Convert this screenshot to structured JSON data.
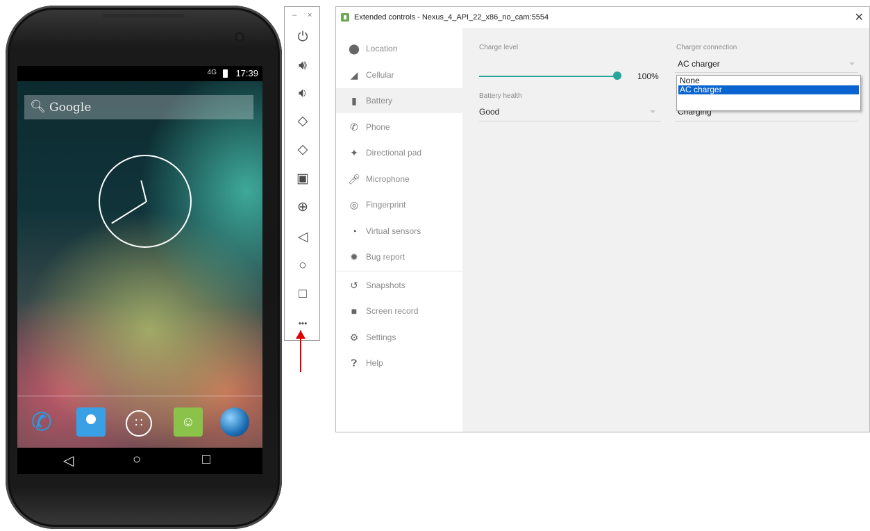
{
  "phone": {
    "status_bar": {
      "network": "4G",
      "time": "17:39"
    },
    "search_hint": "Google",
    "nav_buttons": {
      "back": "◁",
      "home": "○",
      "recents": "□"
    }
  },
  "toolbar": {
    "minimize": "–",
    "close": "×",
    "more": "•••"
  },
  "window": {
    "title": "Extended controls - Nexus_4_API_22_x86_no_cam:5554",
    "close": "✕",
    "nav": [
      {
        "label": "Location"
      },
      {
        "label": "Cellular"
      },
      {
        "label": "Battery"
      },
      {
        "label": "Phone"
      },
      {
        "label": "Directional pad"
      },
      {
        "label": "Microphone"
      },
      {
        "label": "Fingerprint"
      },
      {
        "label": "Virtual sensors"
      },
      {
        "label": "Bug report"
      },
      {
        "label": "Snapshots"
      },
      {
        "label": "Screen record"
      },
      {
        "label": "Settings"
      },
      {
        "label": "Help"
      }
    ],
    "active_nav": "Battery"
  },
  "battery": {
    "charge_level_label": "Charge level",
    "charge_level_value": "100%",
    "charge_level_fraction": 1.0,
    "battery_health_label": "Battery health",
    "battery_health_value": "Good",
    "charger_connection_label": "Charger connection",
    "charger_connection_value": "AC charger",
    "charger_connection_options": [
      "None",
      "AC charger"
    ],
    "battery_status_value": "Charging"
  },
  "colors": {
    "accent": "#26a69a",
    "selection": "#0a64cf",
    "arrow": "#e00000"
  }
}
